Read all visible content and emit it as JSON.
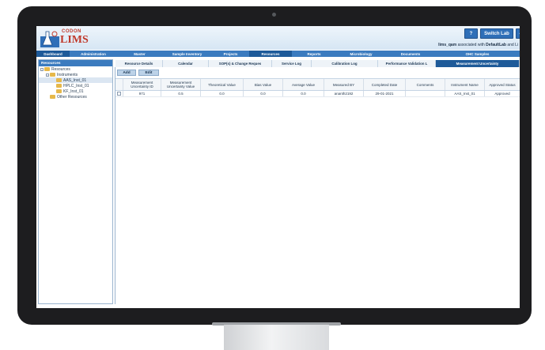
{
  "header": {
    "logo_small": "CODON",
    "logo_big": "LIMS",
    "help_label": "?",
    "switch_lab_label": "Switch Lab",
    "search_label": "⌕",
    "user_name": "lims_qam",
    "user_text": "associated with",
    "lab_name": "DefaultLab",
    "user_suffix": "and Li"
  },
  "nav": {
    "items": [
      {
        "label": "Dashboard"
      },
      {
        "label": "Administration"
      },
      {
        "label": "Master"
      },
      {
        "label": "Sample Inventory"
      },
      {
        "label": "Projects"
      },
      {
        "label": "Resources"
      },
      {
        "label": "Reports"
      },
      {
        "label": "Microbiology"
      },
      {
        "label": "Documents"
      },
      {
        "label": "OHC Samples"
      }
    ]
  },
  "sidebar": {
    "title": "Resources",
    "tree": [
      {
        "label": "Resources"
      },
      {
        "label": "Instruments"
      },
      {
        "label": "AAS_Inst_01"
      },
      {
        "label": "HPLC_Inst_01"
      },
      {
        "label": "KF_Inst_01"
      },
      {
        "label": "Other Resources"
      }
    ]
  },
  "tabs": [
    {
      "label": "Resource Details"
    },
    {
      "label": "Calendar"
    },
    {
      "label": "SOP(s) & Change Reques"
    },
    {
      "label": "Service Log"
    },
    {
      "label": "Calibration Log"
    },
    {
      "label": "Performance Validation L"
    },
    {
      "label": "Measurement Uncertainty"
    }
  ],
  "toolbar": {
    "add_label": "Add",
    "edit_label": "Edit"
  },
  "grid": {
    "columns": [
      "Measurement Uncertainty ID",
      "Measurement Uncertainty Value",
      "Theoretical Value",
      "Bias Value",
      "Average Value",
      "Measured BY",
      "Completed Date",
      "Comments",
      "Instrument Name",
      "Approved Status"
    ],
    "rows": [
      [
        "971",
        "0.5",
        "0.0",
        "0.0",
        "0.0",
        "ananth2192",
        "29-01-2021",
        "",
        "AAS_Inst_01",
        "Approved"
      ]
    ]
  },
  "colors": {
    "nav_blue": "#3b7bbf",
    "nav_active": "#1e5a99",
    "logo_red": "#c0392b"
  }
}
